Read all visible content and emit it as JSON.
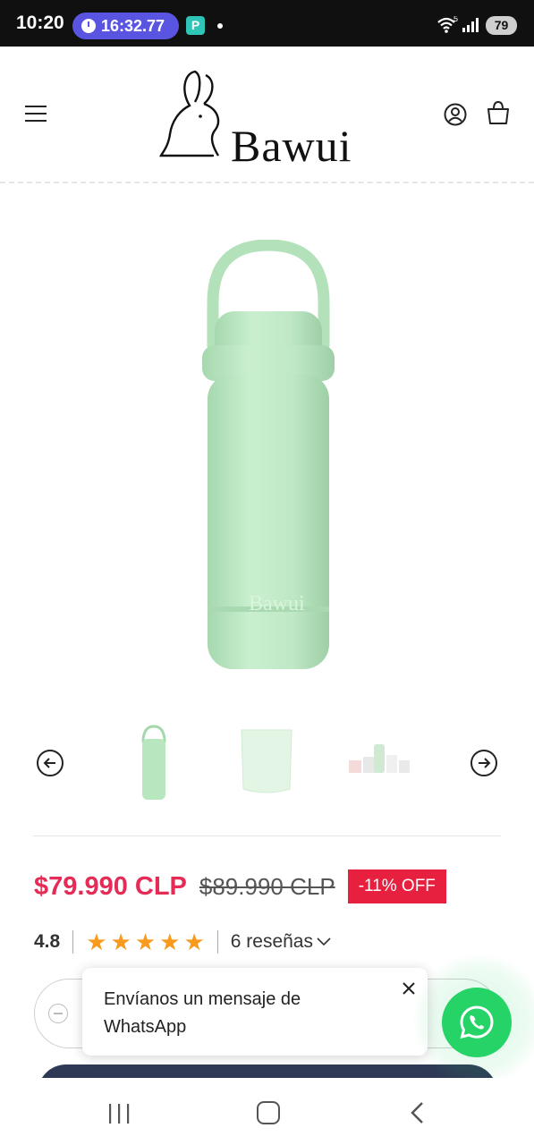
{
  "status_bar": {
    "time": "10:20",
    "timer": "16:32.77",
    "app_badge": "P",
    "battery": "79",
    "wifi_label": "5"
  },
  "header": {
    "brand": "Bawui",
    "icons": [
      "menu-icon",
      "account-icon",
      "cart-icon"
    ]
  },
  "product": {
    "image_color": "#bfe8c6",
    "thumbnails": [
      "bottle-front",
      "bottle-cup",
      "bottle-set"
    ]
  },
  "price": {
    "sale": "$79.990 CLP",
    "regular": "$89.990 CLP",
    "discount": "-11% OFF",
    "sale_color": "#e52c56",
    "badge_color": "#e8203f"
  },
  "rating": {
    "value": "4.8",
    "stars": 5,
    "reviews": "6 reseñas"
  },
  "whatsapp": {
    "message": "Envíanos un mensaje de WhatsApp",
    "accent": "#25d366"
  },
  "colors": {
    "cta": "#2e3a55"
  }
}
